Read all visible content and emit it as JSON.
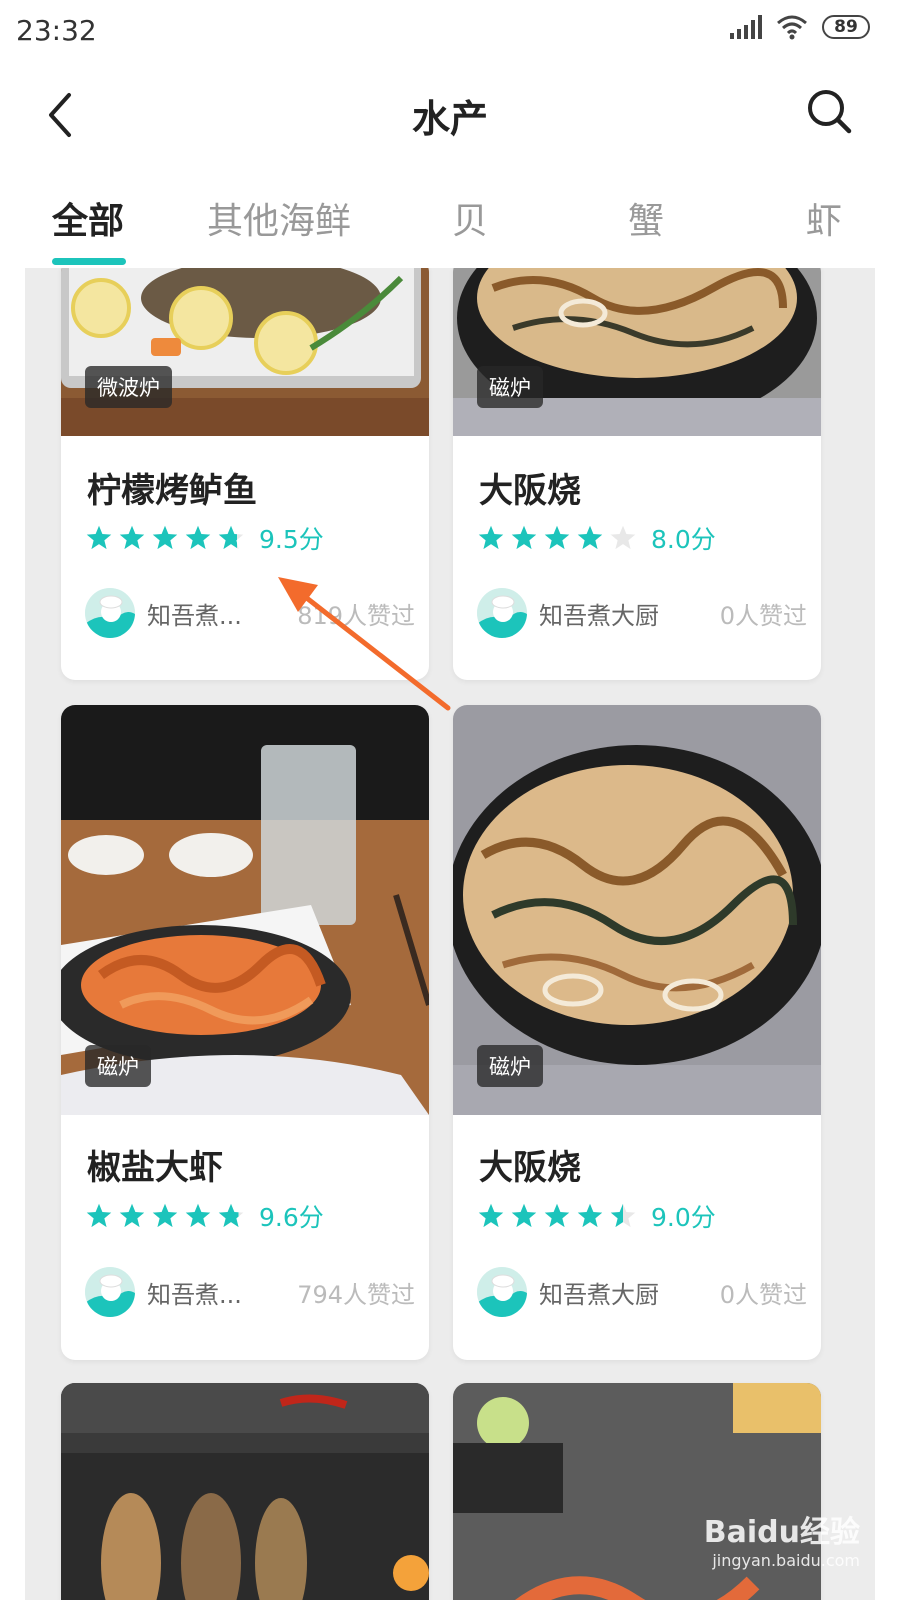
{
  "status_bar": {
    "time": "23:32",
    "battery": "89"
  },
  "header": {
    "title": "水产",
    "back_icon": "chevron-left-icon",
    "search_icon": "search-icon"
  },
  "tabs": [
    {
      "label": "全部",
      "active": true
    },
    {
      "label": "其他海鲜",
      "active": false
    },
    {
      "label": "贝",
      "active": false
    },
    {
      "label": "蟹",
      "active": false
    },
    {
      "label": "虾",
      "active": false
    }
  ],
  "accent_color": "#1cc4bb",
  "cards": [
    {
      "badge": "微波炉",
      "title": "柠檬烤鲈鱼",
      "rating": 9.5,
      "score": "9.5分",
      "author": "知吾煮...",
      "likes": "819人赞过"
    },
    {
      "badge": "磁炉",
      "title": "大阪烧",
      "rating": 8.0,
      "score": "8.0分",
      "author": "知吾煮大厨",
      "likes": "0人赞过"
    },
    {
      "badge": "磁炉",
      "title": "椒盐大虾",
      "rating": 9.6,
      "score": "9.6分",
      "author": "知吾煮...",
      "likes": "794人赞过"
    },
    {
      "badge": "磁炉",
      "title": "大阪烧",
      "rating": 9.0,
      "score": "9.0分",
      "author": "知吾煮大厨",
      "likes": "0人赞过"
    }
  ],
  "watermark": {
    "brand": "Baidu经验",
    "url": "jingyan.baidu.com"
  }
}
